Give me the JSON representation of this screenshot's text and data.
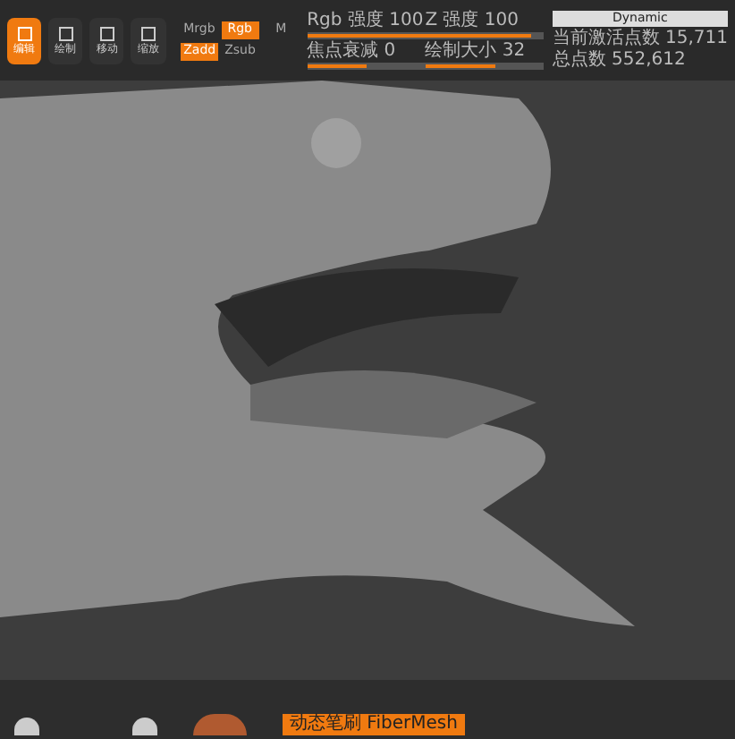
{
  "toolbar": {
    "tools": [
      {
        "label": "编辑",
        "selected": true
      },
      {
        "label": "绘制",
        "selected": false
      },
      {
        "label": "移动",
        "selected": false
      },
      {
        "label": "缩放",
        "selected": false
      }
    ],
    "toggles": [
      {
        "label": "Mrgb",
        "selected": false
      },
      {
        "label": "Rgb",
        "selected": true
      },
      {
        "label": "M",
        "selected": false
      },
      {
        "label": "Zadd",
        "selected": true
      },
      {
        "label": "Zsub",
        "selected": false
      }
    ],
    "sliders": [
      {
        "label": "Rgb 强度 100",
        "level": 1
      },
      {
        "label": "Z 强度 100",
        "level": 0.9
      },
      {
        "label": "焦点衰减 0",
        "level": 0.5
      },
      {
        "label": "绘制大小 32",
        "level": 0.6
      }
    ],
    "dynamic_button": "Dynamic",
    "stats": [
      "当前激活点数 15,711",
      "总点数 552,612"
    ]
  },
  "bottom_bar": {
    "material_label": "动态笔刷 FiberMesh"
  }
}
